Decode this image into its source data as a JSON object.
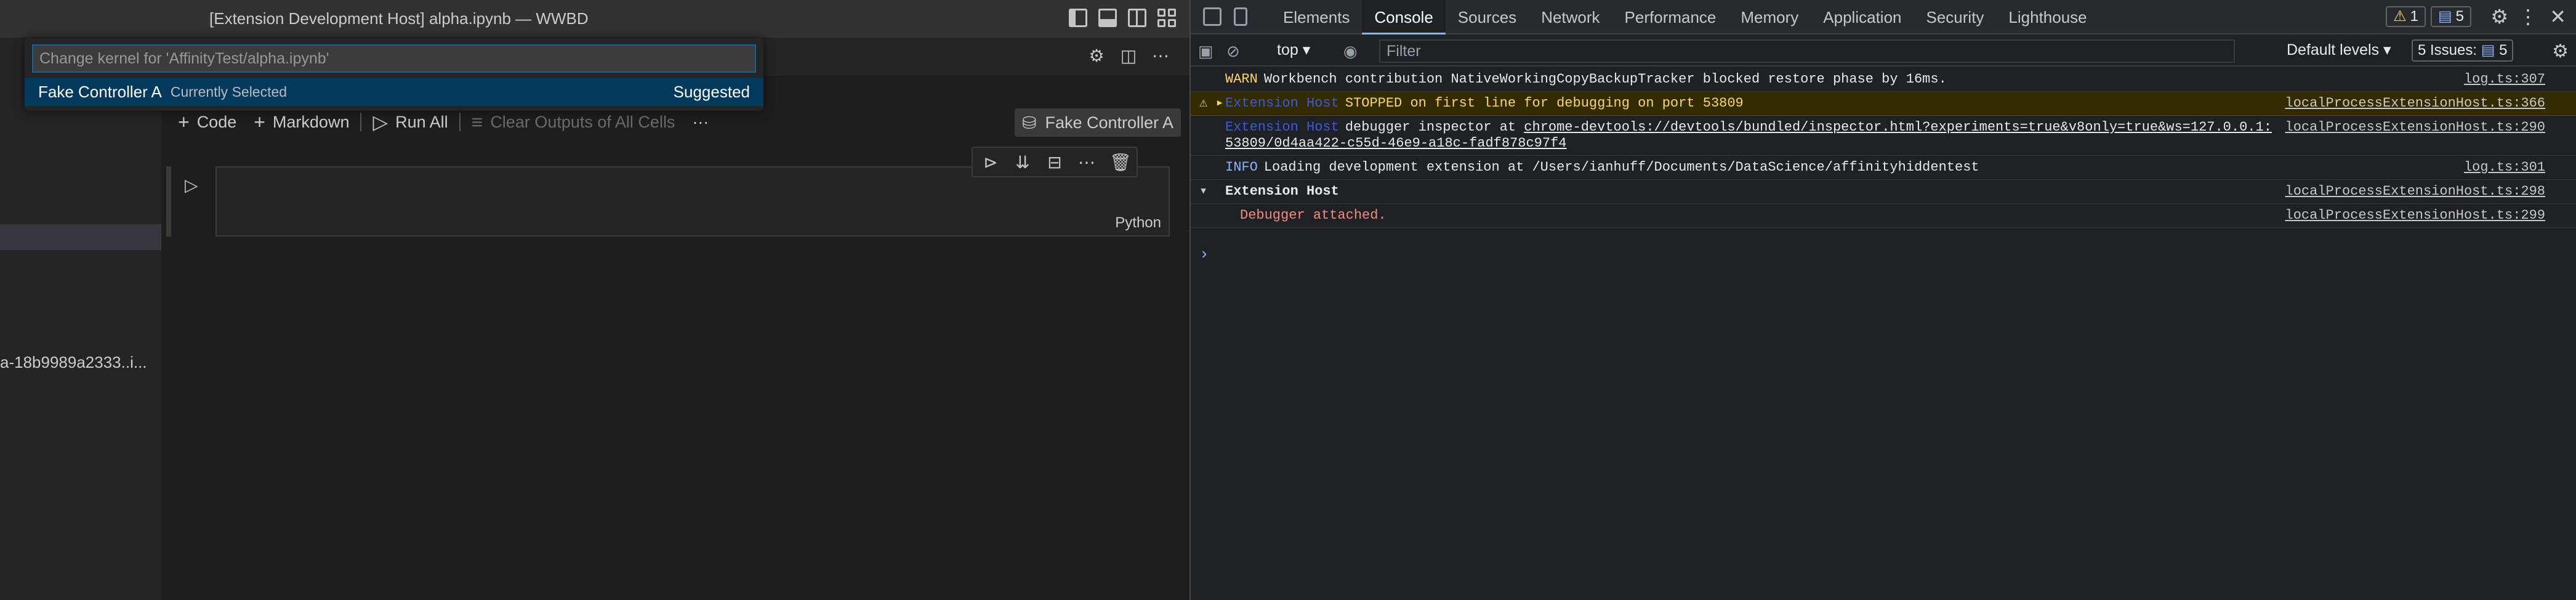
{
  "window": {
    "title": "[Extension Development Host] alpha.ipynb — WWBD"
  },
  "sidebar": {
    "file_label": "a-18b9989a2333..i..."
  },
  "quick_pick": {
    "placeholder": "Change kernel for 'AffinityTest/alpha.ipynb'",
    "item": {
      "label": "Fake Controller A",
      "description": "Currently Selected",
      "detail": "Suggested"
    }
  },
  "notebook_toolbar": {
    "code_label": "Code",
    "markdown_label": "Markdown",
    "run_all_label": "Run All",
    "clear_outputs_label": "Clear Outputs of All Cells",
    "more_label": "···",
    "kernel_label": "Fake Controller A"
  },
  "cell": {
    "language": "Python"
  },
  "devtools": {
    "tabs": [
      "Elements",
      "Console",
      "Sources",
      "Network",
      "Performance",
      "Memory",
      "Application",
      "Security",
      "Lighthouse"
    ],
    "active_tab": "Console",
    "warning_count": "1",
    "message_count": "5",
    "context": "top",
    "filter_placeholder": "Filter",
    "levels_label": "Default levels",
    "issues_label": "5 Issues:",
    "issues_count": "5",
    "logs": [
      {
        "level": "WARN",
        "message": "Workbench contribution NativeWorkingCopyBackupTracker blocked restore phase by 16ms.",
        "source": "log.ts:307"
      },
      {
        "tag": "Extension Host",
        "message": "STOPPED on first line for debugging on port 53809",
        "source": "localProcessExtensionHost.ts:366"
      },
      {
        "tag": "Extension Host",
        "message": "debugger inspector at",
        "url": "chrome-devtools://devtools/bundled/inspector.html?experiments=true&v8only=true&ws=127.0.0.1:53809/0d4aa422-c55d-46e9-a18c-fadf878c97f4",
        "source": "localProcessExtensionHost.ts:290"
      },
      {
        "level": "INFO",
        "message": "Loading development extension at /Users/ianhuff/Documents/DataScience/affinityhiddentest",
        "source": "log.ts:301"
      },
      {
        "group": "Extension Host",
        "source": "localProcessExtensionHost.ts:298"
      },
      {
        "message": "Debugger attached.",
        "source": "localProcessExtensionHost.ts:299"
      }
    ],
    "prompt": "›"
  }
}
